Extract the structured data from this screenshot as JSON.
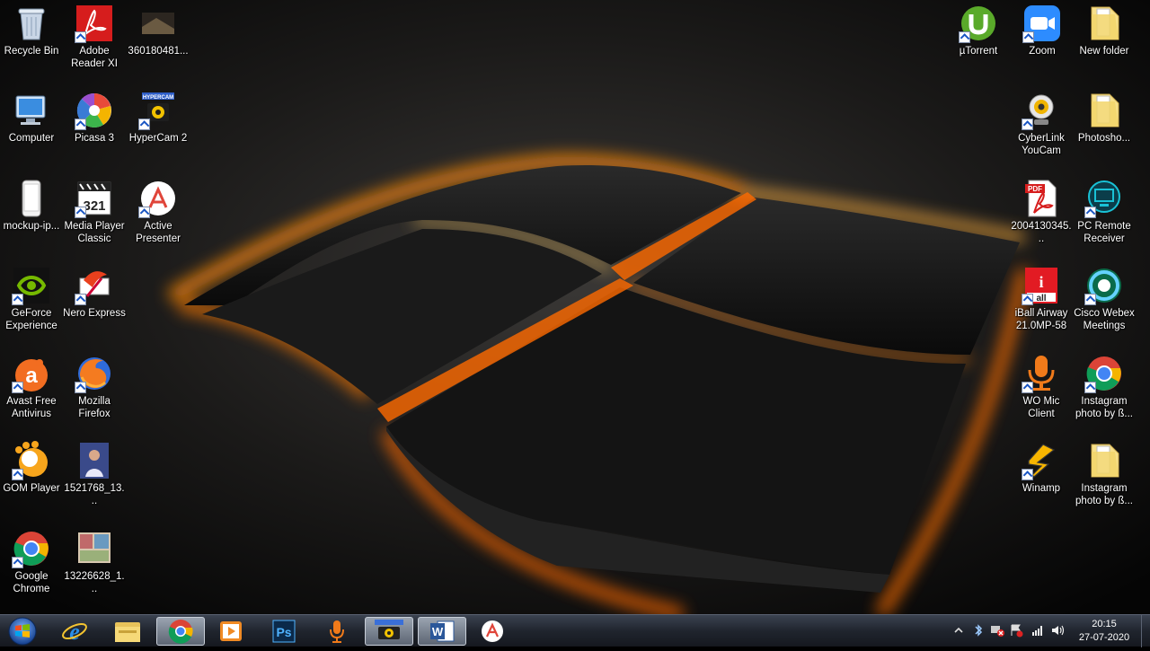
{
  "desktop_left": [
    {
      "id": "recycle",
      "lines": [
        "Recycle Bin"
      ]
    },
    {
      "id": "adobe",
      "lines": [
        "Adobe",
        "Reader XI"
      ]
    },
    {
      "id": "file360",
      "lines": [
        "360180481..."
      ]
    },
    {
      "id": "computer",
      "lines": [
        "Computer"
      ]
    },
    {
      "id": "picasa",
      "lines": [
        "Picasa 3"
      ]
    },
    {
      "id": "hypercam",
      "lines": [
        "HyperCam 2"
      ]
    },
    {
      "id": "mockup",
      "lines": [
        "mockup-ip..."
      ]
    },
    {
      "id": "mpc",
      "lines": [
        "Media Player",
        "Classic"
      ]
    },
    {
      "id": "activepres",
      "lines": [
        "Active",
        "Presenter"
      ]
    },
    {
      "id": "geforce",
      "lines": [
        "GeForce",
        "Experience"
      ]
    },
    {
      "id": "nero",
      "lines": [
        "Nero Express"
      ]
    },
    {
      "id": "avast",
      "lines": [
        "Avast Free",
        "Antivirus"
      ]
    },
    {
      "id": "firefox",
      "lines": [
        "Mozilla",
        "Firefox"
      ]
    },
    {
      "id": "gom",
      "lines": [
        "GOM Player"
      ]
    },
    {
      "id": "photo1521",
      "lines": [
        "1521768_13..."
      ]
    },
    {
      "id": "chrome",
      "lines": [
        "Google",
        "Chrome"
      ]
    },
    {
      "id": "photo1322",
      "lines": [
        "13226628_1..."
      ]
    }
  ],
  "desktop_right": [
    {
      "id": "utorrent",
      "lines": [
        "µTorrent"
      ]
    },
    {
      "id": "zoom",
      "lines": [
        "Zoom"
      ]
    },
    {
      "id": "newfolder",
      "lines": [
        "New folder"
      ]
    },
    {
      "id": "youcam",
      "lines": [
        "CyberLink",
        "YouCam"
      ]
    },
    {
      "id": "photoshop-folder",
      "lines": [
        "Photosho..."
      ]
    },
    {
      "id": "pdf2004",
      "lines": [
        "2004130345..."
      ]
    },
    {
      "id": "pcremote",
      "lines": [
        "PC Remote",
        "Receiver"
      ]
    },
    {
      "id": "iball",
      "lines": [
        "iBall Airway",
        "21.0MP-58"
      ]
    },
    {
      "id": "webex",
      "lines": [
        "Cisco Webex",
        "Meetings"
      ]
    },
    {
      "id": "womic",
      "lines": [
        "WO Mic",
        "Client"
      ]
    },
    {
      "id": "insta-chrome",
      "lines": [
        "Instagram",
        "photo by ß..."
      ]
    },
    {
      "id": "winamp",
      "lines": [
        "Winamp"
      ]
    },
    {
      "id": "insta-folder",
      "lines": [
        "Instagram",
        "photo by ß..."
      ]
    }
  ],
  "iball_badge": {
    "letter": "i",
    "small": "all"
  },
  "hypercam_logo": "HYPERCAM",
  "pdf_badge": "PDF",
  "mpc_badge": "321",
  "taskbar": {
    "start": "windows-start-orb",
    "pinned": [
      "internet-explorer",
      "file-explorer",
      "google-chrome",
      "media-player",
      "photoshop",
      "wo-mic",
      "hypercam",
      "microsoft-word",
      "active-presenter"
    ],
    "active": [
      "google-chrome",
      "hypercam",
      "microsoft-word"
    ]
  },
  "clock": {
    "time": "20:15",
    "date": "27-07-2020"
  },
  "colors": {
    "accent_orange": "#ff9a1a",
    "taskbar": "#20252e"
  }
}
